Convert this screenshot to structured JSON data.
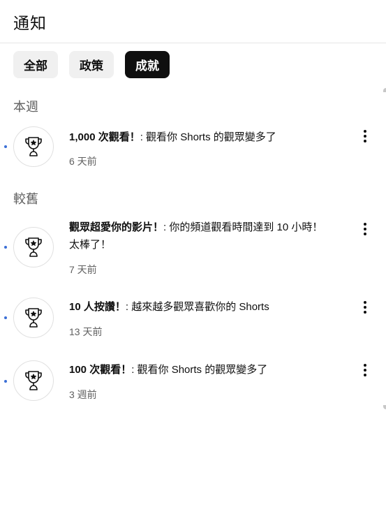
{
  "header": {
    "title": "通知"
  },
  "chips": [
    {
      "label": "全部",
      "active": false
    },
    {
      "label": "政策",
      "active": false
    },
    {
      "label": "成就",
      "active": true
    }
  ],
  "sections": {
    "this_week": "本週",
    "older": "較舊"
  },
  "notifications": [
    {
      "title": "1,000 次觀看！",
      "message": ": 觀看你 Shorts 的觀眾變多了",
      "time": "6 天前",
      "icon": "trophy-icon",
      "unread": true
    },
    {
      "title": "觀眾超愛你的影片！",
      "message": ": 你的頻道觀看時間達到 10 小時！太棒了！",
      "time": "7 天前",
      "icon": "trophy-icon",
      "unread": true
    },
    {
      "title": "10 人按讚！",
      "message": ": 越來越多觀眾喜歡你的 Shorts",
      "time": "13 天前",
      "icon": "trophy-icon",
      "unread": true
    },
    {
      "title": "100 次觀看！",
      "message": ": 觀看你 Shorts 的觀眾變多了",
      "time": "3 週前",
      "icon": "trophy-icon",
      "unread": true
    }
  ],
  "colors": {
    "unread_dot": "#3b6fd6",
    "chip_active_bg": "#0f0f0f",
    "chip_bg": "#f0f0f0"
  }
}
